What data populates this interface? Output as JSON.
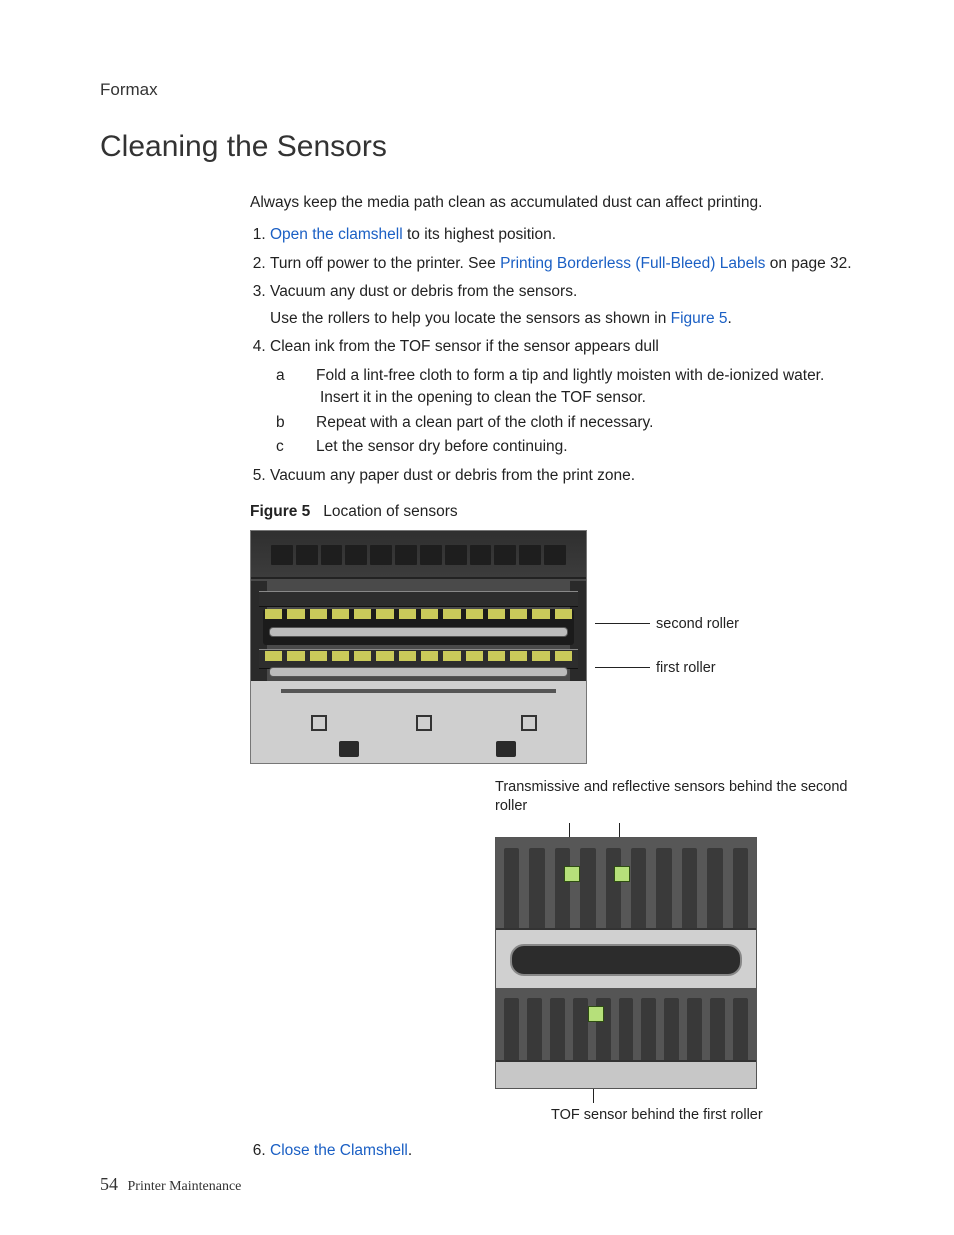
{
  "brand": "Formax",
  "title": "Cleaning the Sensors",
  "intro": "Always keep the media path clean as accumulated dust can affect printing.",
  "steps": {
    "s1": {
      "link": "Open the clamshell",
      "after": " to its highest position."
    },
    "s2": {
      "before": "Turn off power to the printer. See ",
      "link": "Printing Borderless (Full-Bleed) Labels",
      "after": " on page 32."
    },
    "s3": {
      "line1": "Vacuum any dust or debris from the sensors.",
      "line2_before": "Use the rollers to help you locate the sensors as shown in ",
      "line2_link": "Figure 5",
      "line2_after": "."
    },
    "s4": {
      "intro": "Clean ink from the TOF sensor if the sensor appears dull",
      "a": "Fold a lint-free cloth to form a tip and lightly moisten with de-ionized water. Insert it in the opening to clean the TOF sensor.",
      "b": "Repeat with a clean part of the cloth if necessary.",
      "c": "Let the sensor dry before continuing."
    },
    "s5": "Vacuum any paper dust or debris from the print zone.",
    "s6": {
      "link": "Close the Clamshell",
      "after": "."
    }
  },
  "figure": {
    "label": "Figure 5",
    "caption": "Location of sensors",
    "callout_second_roller": "second roller",
    "callout_first_roller": "first roller",
    "fig2_top": "Transmissive and reflective sensors behind the second roller",
    "fig2_bottom": "TOF sensor behind the first roller"
  },
  "footer": {
    "page": "54",
    "section": "Printer Maintenance"
  }
}
